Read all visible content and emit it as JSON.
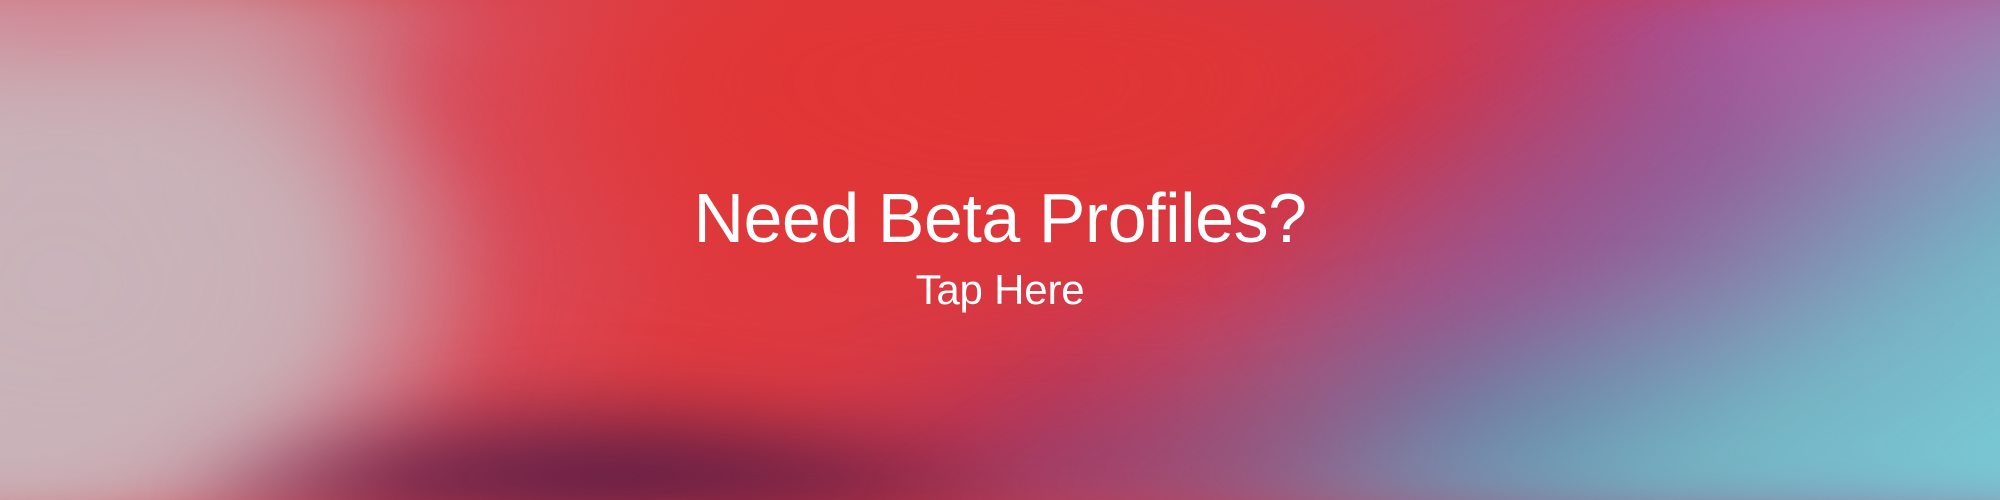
{
  "banner": {
    "headline": "Need Beta Profiles?",
    "cta": "Tap Here",
    "colors": {
      "text": "#ffffff",
      "red": "#e13534",
      "pink": "#d65467",
      "purple": "#b24484",
      "blue": "#4b5b8c",
      "cyan": "#7bd6dc"
    }
  }
}
